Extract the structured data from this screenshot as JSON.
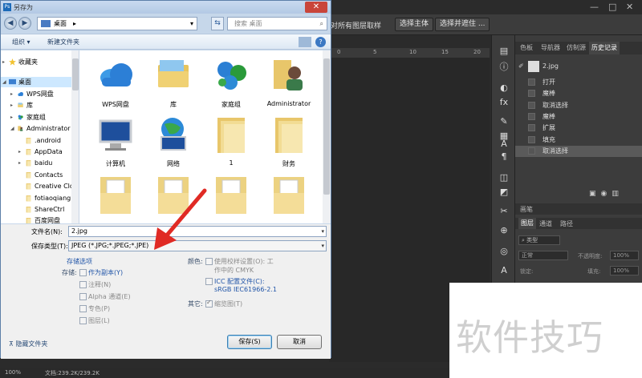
{
  "dialog": {
    "title": "另存为",
    "address": "桌面",
    "search_placeholder": "搜索 桌面",
    "toolbar": {
      "organize": "组织 ▾",
      "new_folder": "新建文件夹"
    },
    "tree": [
      {
        "label": "收藏夹",
        "indent": 0,
        "icon": "star",
        "expander": "▸"
      },
      {
        "label": "桌面",
        "indent": 0,
        "icon": "desktop",
        "expander": "◢",
        "selected": true
      },
      {
        "label": "WPS网盘",
        "indent": 1,
        "icon": "cloud",
        "expander": "▸"
      },
      {
        "label": "库",
        "indent": 1,
        "icon": "library",
        "expander": "▸"
      },
      {
        "label": "家庭组",
        "indent": 1,
        "icon": "homegroup",
        "expander": "▸"
      },
      {
        "label": "Administrator",
        "indent": 1,
        "icon": "user",
        "expander": "◢"
      },
      {
        "label": ".android",
        "indent": 2,
        "icon": "folder",
        "expander": ""
      },
      {
        "label": "AppData",
        "indent": 2,
        "icon": "folder",
        "expander": "▸"
      },
      {
        "label": "baidu",
        "indent": 2,
        "icon": "folder",
        "expander": "▸"
      },
      {
        "label": "Contacts",
        "indent": 2,
        "icon": "folder",
        "expander": ""
      },
      {
        "label": "Creative Clo",
        "indent": 2,
        "icon": "folder",
        "expander": ""
      },
      {
        "label": "fotiaoqiang",
        "indent": 2,
        "icon": "folder",
        "expander": ""
      },
      {
        "label": "ShareCtrl",
        "indent": 2,
        "icon": "folder",
        "expander": ""
      },
      {
        "label": "百度网盘",
        "indent": 2,
        "icon": "folder",
        "expander": ""
      }
    ],
    "files": [
      {
        "label": "WPS网盘",
        "icon": "cloud"
      },
      {
        "label": "库",
        "icon": "library"
      },
      {
        "label": "家庭组",
        "icon": "homegroup"
      },
      {
        "label": "Administrator",
        "icon": "user"
      },
      {
        "label": "计算机",
        "icon": "computer"
      },
      {
        "label": "网络",
        "icon": "network"
      },
      {
        "label": "1",
        "icon": "folder"
      },
      {
        "label": "财务",
        "icon": "folder"
      },
      {
        "label": "",
        "icon": "folder-doc"
      },
      {
        "label": "",
        "icon": "folder-doc"
      },
      {
        "label": "",
        "icon": "folder-doc"
      },
      {
        "label": "",
        "icon": "folder-doc"
      }
    ],
    "filename_label": "文件名(N):",
    "filename_value": "2.jpg",
    "filetype_label": "保存类型(T):",
    "filetype_value": "JPEG (*.JPG;*.JPEG;*.JPE)",
    "save_options_title": "存储选项",
    "storage_label": "存储:",
    "storage_options": [
      {
        "label": "作为副本(Y)",
        "enabled": true,
        "checked": false
      },
      {
        "label": "注释(N)",
        "enabled": false,
        "checked": false
      },
      {
        "label": "Alpha 通道(E)",
        "enabled": false,
        "checked": false
      },
      {
        "label": "专色(P)",
        "enabled": false,
        "checked": false
      },
      {
        "label": "图层(L)",
        "enabled": false,
        "checked": false
      }
    ],
    "color_label": "颜色:",
    "proof_setup": "使用校样设置(O): 工",
    "proof_setup_2": "作中的 CMYK",
    "icc_label": "ICC 配置文件(C):",
    "icc_value": "sRGB IEC61966-2.1",
    "other_label": "其它:",
    "thumbnail_label": "缩览图(T)",
    "hide_folders": "隐藏文件夹",
    "save_button": "保存(S)",
    "cancel_button": "取消"
  },
  "photoshop": {
    "options_text": "对所有图层取样",
    "btn_select_subject": "选择主体",
    "btn_select_mask": "选择并遮住 ...",
    "ruler_ticks": [
      "0",
      "5",
      "10",
      "15",
      "20"
    ],
    "panel_tabs": [
      "色板",
      "导航器",
      "仿制源",
      "历史记录"
    ],
    "history_snapshot": "2.jpg",
    "history": [
      "打开",
      "魔棒",
      "取消选择",
      "魔棒",
      "扩展",
      "填充",
      "取消选择"
    ],
    "brush_tab": "画笔",
    "layer_tabs": [
      "图层",
      "通道",
      "路径"
    ],
    "layer_filter": "类型",
    "blend_mode": "正常",
    "opacity_label": "不透明度:",
    "opacity_value": "100%",
    "lock_label": "锁定:",
    "fill_label": "填充:",
    "fill_value": "100%",
    "zoom": "100%",
    "doc_info": "文档:239.2K/239.2K"
  },
  "watermark": "软件技巧"
}
